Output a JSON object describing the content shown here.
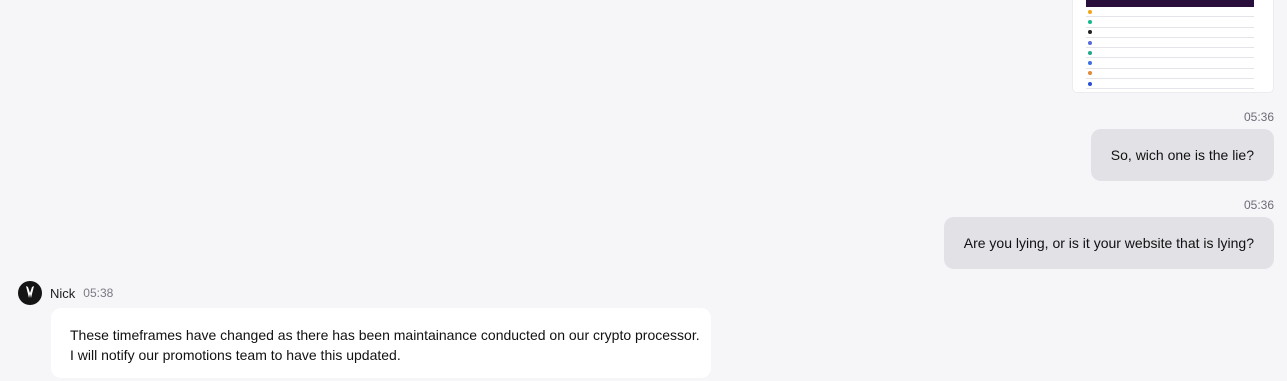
{
  "thumbnail": {
    "rows": [
      {
        "color": "#f3a51a"
      },
      {
        "color": "#17b88a"
      },
      {
        "color": "#222222"
      },
      {
        "color": "#5a6ad8"
      },
      {
        "color": "#22a88f"
      },
      {
        "color": "#3f6fe0"
      },
      {
        "color": "#e08a3a"
      },
      {
        "color": "#2b4fd6"
      }
    ]
  },
  "messages": [
    {
      "time": "05:36",
      "text": "So, wich one is the lie?"
    },
    {
      "time": "05:36",
      "text": "Are you lying, or is it your website that is lying?"
    }
  ],
  "agent": {
    "name": "Nick",
    "time": "05:38",
    "lines": [
      "These timeframes have changed as there has been maintainance conducted on our crypto processor.",
      "I will notify our promotions team to have this updated."
    ]
  },
  "colors": {
    "background": "#f6f6f8",
    "outgoing_bubble": "#e1e1e6",
    "incoming_bubble": "#ffffff",
    "table_header": "#2a0f3d"
  }
}
